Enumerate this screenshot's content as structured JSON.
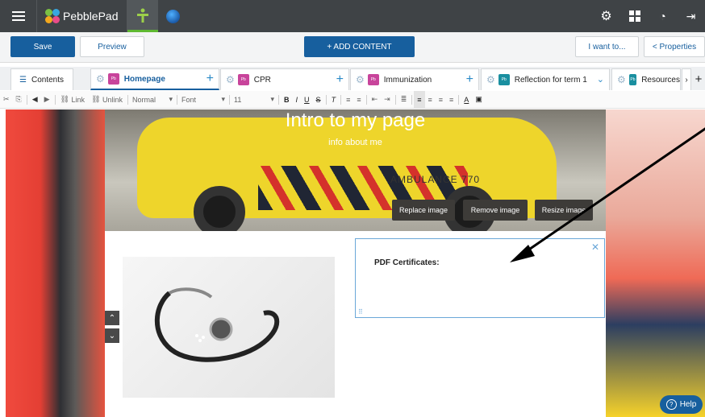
{
  "topbar": {
    "app_name": "PebblePad",
    "icons": [
      "menu-icon",
      "pebblepad-logo-icon",
      "add-person-icon",
      "globe-icon",
      "gear-icon",
      "dashboard-icon",
      "history-icon",
      "logout-icon"
    ]
  },
  "actionbar": {
    "save": "Save",
    "preview": "Preview",
    "add_content": "+ ADD CONTENT",
    "i_want_to": "I want to...",
    "properties": "< Properties"
  },
  "tabs": {
    "contents": "Contents",
    "pb_badge": "Pb",
    "items": [
      {
        "label": "Homepage"
      },
      {
        "label": "CPR"
      },
      {
        "label": "Immunization"
      },
      {
        "label": "Reflection for term 1"
      },
      {
        "label": "Resources"
      }
    ]
  },
  "toolbar": {
    "link": "Link",
    "unlink": "Unlink",
    "format": "Normal",
    "font": "Font",
    "size": "11"
  },
  "hero": {
    "title": "Intro to my page",
    "subtitle": "info about me",
    "van_text": "AMBULANCE   770",
    "replace_image": "Replace image",
    "remove_image": "Remove image",
    "resize_image": "Resize image"
  },
  "textbox": {
    "content": "PDF Certificates:"
  },
  "help": {
    "label": "Help"
  },
  "colors": {
    "topbar": "#3f4346",
    "primary": "#175f9e",
    "accent_green": "#5fb832"
  }
}
